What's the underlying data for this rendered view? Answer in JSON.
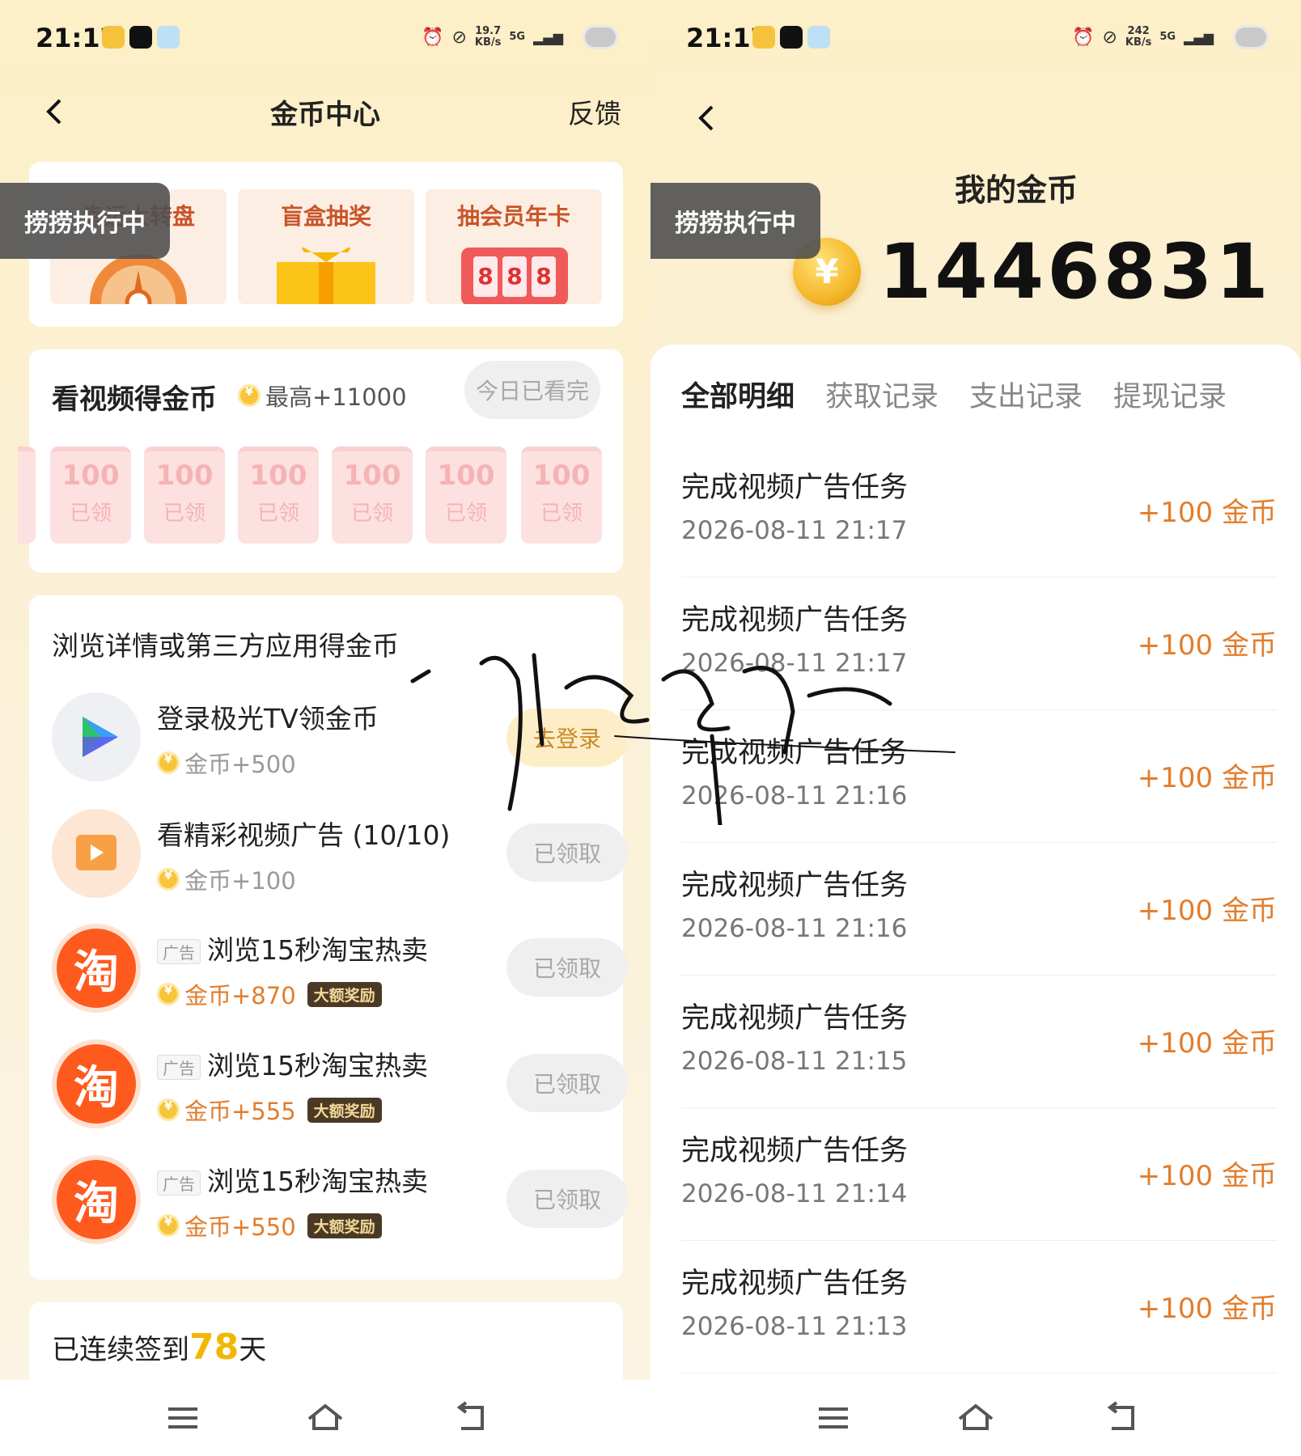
{
  "left": {
    "status": {
      "time": "21:17",
      "speed_value": "19.7",
      "speed_unit": "KB/s",
      "network": "5G"
    },
    "nav": {
      "title": "金币中心",
      "feedback": "反馈"
    },
    "floating_badge": "捞捞执行中",
    "lottery": [
      {
        "label": "幸运大转盘"
      },
      {
        "label": "盲盒抽奖"
      },
      {
        "label": "抽会员年卡"
      }
    ],
    "slot_digits": [
      "8",
      "8",
      "8"
    ],
    "video": {
      "title": "看视频得金币",
      "max": "最高+11000",
      "button": "今日已看完",
      "envelopes": [
        {
          "amount": "100",
          "state": "已领"
        },
        {
          "amount": "100",
          "state": "已领"
        },
        {
          "amount": "100",
          "state": "已领"
        },
        {
          "amount": "100",
          "state": "已领"
        },
        {
          "amount": "100",
          "state": "已领"
        },
        {
          "amount": "100",
          "state": "已领"
        }
      ]
    },
    "browse": {
      "title": "浏览详情或第三方应用得金币",
      "tasks": [
        {
          "title": "登录极光TV领金币",
          "reward": "金币+500",
          "button": "去登录"
        },
        {
          "title": "看精彩视频广告 (10/10)",
          "reward": "金币+100",
          "button": "已领取"
        },
        {
          "ad_tag": "广告",
          "title": "浏览15秒淘宝热卖",
          "reward": "金币+870",
          "badge": "大额奖励",
          "button": "已领取",
          "icon_text": "淘"
        },
        {
          "ad_tag": "广告",
          "title": "浏览15秒淘宝热卖",
          "reward": "金币+555",
          "badge": "大额奖励",
          "button": "已领取",
          "icon_text": "淘"
        },
        {
          "ad_tag": "广告",
          "title": "浏览15秒淘宝热卖",
          "reward": "金币+550",
          "badge": "大额奖励",
          "button": "已领取",
          "icon_text": "淘"
        }
      ]
    },
    "signin": {
      "prefix": "已连续签到",
      "days": "78",
      "suffix": "天"
    }
  },
  "right": {
    "status": {
      "time": "21:17",
      "speed_value": "242",
      "speed_unit": "KB/s",
      "network": "5G"
    },
    "floating_badge": "捞捞执行中",
    "my_coin_title": "我的金币",
    "coin_total": "1446831",
    "coin_symbol": "¥",
    "tabs": [
      "全部明细",
      "获取记录",
      "支出记录",
      "提现记录"
    ],
    "records": [
      {
        "title": "完成视频广告任务",
        "time": "2026-08-11 21:17",
        "amount": "+100",
        "unit": "金币"
      },
      {
        "title": "完成视频广告任务",
        "time": "2026-08-11 21:17",
        "amount": "+100",
        "unit": "金币"
      },
      {
        "title": "完成视频广告任务",
        "time": "2026-08-11 21:16",
        "amount": "+100",
        "unit": "金币"
      },
      {
        "title": "完成视频广告任务",
        "time": "2026-08-11 21:16",
        "amount": "+100",
        "unit": "金币"
      },
      {
        "title": "完成视频广告任务",
        "time": "2026-08-11 21:15",
        "amount": "+100",
        "unit": "金币"
      },
      {
        "title": "完成视频广告任务",
        "time": "2026-08-11 21:14",
        "amount": "+100",
        "unit": "金币"
      },
      {
        "title": "完成视频广告任务",
        "time": "2026-08-11 21:13",
        "amount": "+100",
        "unit": "金币"
      }
    ]
  },
  "colors": {
    "accent_orange": "#e27d2c",
    "coin_gold": "#f7c53a",
    "taobao_orange": "#ff5a1e",
    "page_bg": "#fdefc6"
  }
}
